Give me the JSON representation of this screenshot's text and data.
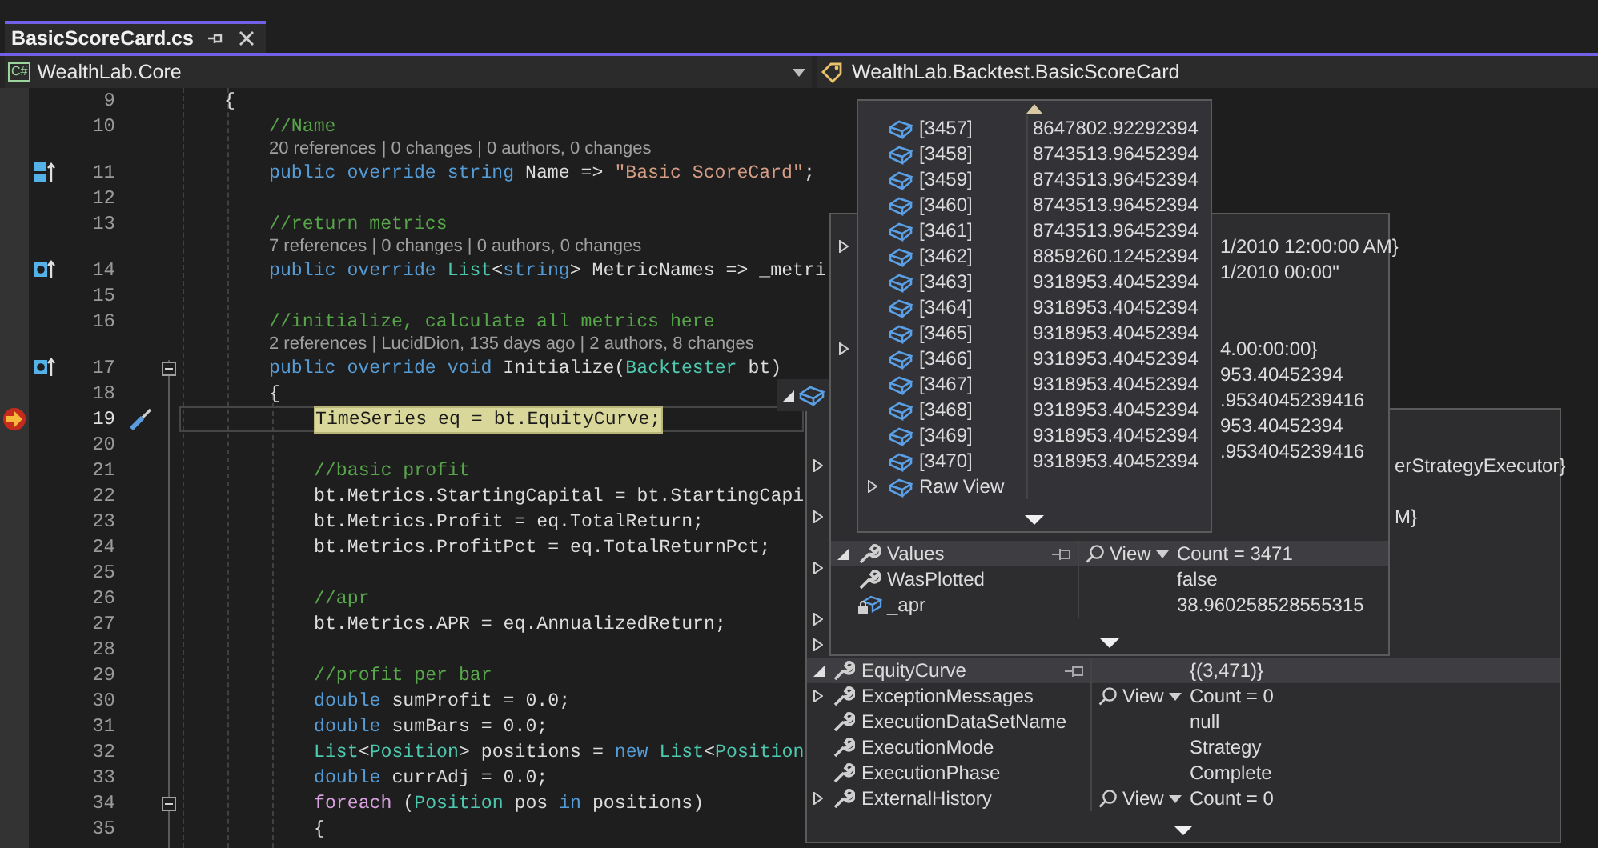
{
  "tabs": [
    {
      "label": "BasicScoreCard.cs",
      "selected": true
    }
  ],
  "navigation": {
    "project_badge": "C#",
    "project": "WealthLab.Core",
    "member": "WealthLab.Backtest.BasicScoreCard"
  },
  "editor": {
    "lines": [
      {
        "kind": "code",
        "number": "9",
        "tokens": [
          {
            "kind": "plain",
            "text": "{"
          }
        ],
        "children": [
          {
            "kind": "code",
            "number": "10",
            "tokens": [
              {
                "kind": "comment",
                "text": "//Name"
              }
            ]
          },
          {
            "kind": "lens",
            "text": "20 references | 0 changes | 0 authors, 0 changes"
          },
          {
            "kind": "property",
            "number": "11",
            "tokens": [
              {
                "kind": "keyword",
                "text": "public override string"
              },
              {
                "kind": "plain",
                "text": " Name => "
              },
              {
                "kind": "string",
                "text": "\"Basic ScoreCard\""
              },
              {
                "kind": "plain",
                "text": ";"
              }
            ]
          },
          {
            "kind": "code",
            "number": "12"
          },
          {
            "kind": "code",
            "number": "13",
            "tokens": [
              {
                "kind": "comment",
                "text": "//return metrics"
              }
            ]
          },
          {
            "kind": "lens",
            "text": "7 references | 0 changes | 0 authors, 0 changes"
          },
          {
            "kind": "method",
            "number": "14",
            "tokens": [
              {
                "kind": "keyword",
                "text": "public override "
              },
              {
                "kind": "type",
                "text": "List"
              },
              {
                "kind": "plain",
                "text": "<"
              },
              {
                "kind": "keyword",
                "text": "string"
              },
              {
                "kind": "plain",
                "text": "> MetricNames => _metri"
              }
            ]
          },
          {
            "kind": "code",
            "number": "15"
          },
          {
            "kind": "code",
            "number": "16",
            "tokens": [
              {
                "kind": "comment",
                "text": "//initialize, calculate all metrics here"
              }
            ]
          },
          {
            "kind": "lens",
            "text": "2 references | LucidDion, 135 days ago | 2 authors, 8 changes"
          },
          {
            "kind": "method",
            "number": "17",
            "expanded": true,
            "tokens": [
              {
                "kind": "keyword",
                "text": "public override void"
              },
              {
                "kind": "plain",
                "text": " Initialize("
              },
              {
                "kind": "type",
                "text": "Backtester"
              },
              {
                "kind": "plain",
                "text": " bt)"
              }
            ]
          },
          {
            "kind": "code",
            "number": "18",
            "tokens": [
              {
                "kind": "plain",
                "text": "{"
              }
            ],
            "children": [
              {
                "kind": "code",
                "number": "19",
                "current": true,
                "tokens": [
                  {
                    "kind": "plain",
                    "text": "TimeSeries eq = bt.EquityCurve;"
                  }
                ]
              },
              {
                "kind": "code",
                "number": "20"
              },
              {
                "kind": "code",
                "number": "21",
                "tokens": [
                  {
                    "kind": "comment",
                    "text": "//basic profit"
                  }
                ]
              },
              {
                "kind": "code",
                "number": "22",
                "tokens": [
                  {
                    "kind": "plain",
                    "text": "bt.Metrics.StartingCapital = bt.StartingCapi"
                  }
                ]
              },
              {
                "kind": "code",
                "number": "23",
                "tokens": [
                  {
                    "kind": "plain",
                    "text": "bt.Metrics.Profit = eq.TotalReturn;"
                  }
                ]
              },
              {
                "kind": "code",
                "number": "24",
                "tokens": [
                  {
                    "kind": "plain",
                    "text": "bt.Metrics.ProfitPct = eq.TotalReturnPct;"
                  }
                ]
              },
              {
                "kind": "code",
                "number": "25"
              },
              {
                "kind": "code",
                "number": "26",
                "tokens": [
                  {
                    "kind": "comment",
                    "text": "//apr"
                  }
                ]
              },
              {
                "kind": "code",
                "number": "27",
                "tokens": [
                  {
                    "kind": "plain",
                    "text": "bt.Metrics.APR = eq.AnnualizedReturn;"
                  }
                ]
              },
              {
                "kind": "code",
                "number": "28"
              },
              {
                "kind": "code",
                "number": "29",
                "tokens": [
                  {
                    "kind": "comment",
                    "text": "//profit per bar"
                  }
                ]
              },
              {
                "kind": "code",
                "number": "30",
                "tokens": [
                  {
                    "kind": "keyword",
                    "text": "double"
                  },
                  {
                    "kind": "plain",
                    "text": " sumProfit = 0.0;"
                  }
                ]
              },
              {
                "kind": "code",
                "number": "31",
                "tokens": [
                  {
                    "kind": "keyword",
                    "text": "double"
                  },
                  {
                    "kind": "plain",
                    "text": " sumBars = 0.0;"
                  }
                ]
              },
              {
                "kind": "code",
                "number": "32",
                "tokens": [
                  {
                    "kind": "type",
                    "text": "List"
                  },
                  {
                    "kind": "plain",
                    "text": "<"
                  },
                  {
                    "kind": "type",
                    "text": "Position"
                  },
                  {
                    "kind": "plain",
                    "text": "> positions = "
                  },
                  {
                    "kind": "keyword",
                    "text": "new "
                  },
                  {
                    "kind": "type",
                    "text": "List"
                  },
                  {
                    "kind": "plain",
                    "text": "<"
                  },
                  {
                    "kind": "type",
                    "text": "Position"
                  }
                ]
              },
              {
                "kind": "code",
                "number": "33",
                "tokens": [
                  {
                    "kind": "keyword",
                    "text": "double"
                  },
                  {
                    "kind": "plain",
                    "text": " currAdj = 0.0;"
                  }
                ]
              },
              {
                "kind": "code",
                "number": "34",
                "expanded": true,
                "tokens": [
                  {
                    "kind": "control",
                    "text": "foreach"
                  },
                  {
                    "kind": "plain",
                    "text": " ("
                  },
                  {
                    "kind": "type",
                    "text": "Position"
                  },
                  {
                    "kind": "plain",
                    "text": " pos "
                  },
                  {
                    "kind": "keyword",
                    "text": "in"
                  },
                  {
                    "kind": "plain",
                    "text": " positions)"
                  }
                ]
              },
              {
                "kind": "code",
                "number": "35",
                "tokens": [
                  {
                    "kind": "plain",
                    "text": "{"
                  }
                ]
              }
            ]
          }
        ]
      }
    ]
  },
  "datatip_root": {
    "expanded": true
  },
  "datatips": [
    {
      "scroll_down": true,
      "rows": [
        {
          "kind": "covered",
          "expanded": false,
          "value": "erStrategyExecutor}"
        },
        {
          "kind": "covered"
        },
        {
          "kind": "covered",
          "expanded": false,
          "value": "M}"
        },
        {
          "kind": "covered"
        },
        {
          "kind": "covered",
          "expanded": false
        },
        {
          "kind": "covered"
        },
        {
          "kind": "covered",
          "expanded": false
        },
        {
          "kind": "covered",
          "expanded": false
        },
        {
          "kind": "property",
          "expanded": true,
          "selected": true,
          "name": "EquityCurve",
          "value": "{(3,471)}"
        },
        {
          "kind": "property",
          "expanded": false,
          "selected": false,
          "name": "ExceptionMessages",
          "viewer": "View",
          "value": "Count = 0"
        },
        {
          "kind": "property",
          "selected": false,
          "name": "ExecutionDataSetName",
          "value": "null"
        },
        {
          "kind": "property",
          "selected": false,
          "name": "ExecutionMode",
          "value": "Strategy"
        },
        {
          "kind": "property",
          "selected": false,
          "name": "ExecutionPhase",
          "value": "Complete"
        },
        {
          "kind": "property",
          "expanded": false,
          "selected": false,
          "name": "ExternalHistory",
          "viewer": "View",
          "value": "Count = 0"
        }
      ]
    },
    {
      "scroll_down": true,
      "rows": [
        {
          "kind": "covered",
          "expanded": false,
          "value": "1/2010 12:00:00 AM}"
        },
        {
          "kind": "covered",
          "value": "1/2010 00:00\""
        },
        {
          "kind": "covered"
        },
        {
          "kind": "covered"
        },
        {
          "kind": "covered",
          "expanded": false,
          "value": "4.00:00:00}"
        },
        {
          "kind": "covered",
          "value": "953.40452394"
        },
        {
          "kind": "covered",
          "value": ".9534045239416"
        },
        {
          "kind": "covered",
          "value": "953.40452394"
        },
        {
          "kind": "covered",
          "value": ".9534045239416"
        },
        {
          "kind": "covered"
        },
        {
          "kind": "covered"
        },
        {
          "kind": "covered"
        },
        {
          "kind": "property",
          "expanded": true,
          "selected": true,
          "name": "Values",
          "viewer": "View",
          "value": "Count = 3471"
        },
        {
          "kind": "property",
          "selected": false,
          "name": "WasPlotted",
          "value": "false"
        },
        {
          "kind": "field",
          "selected": false,
          "name": "_apr",
          "value": "38.960258528555315"
        }
      ]
    },
    {
      "scroll_up": true,
      "scroll_down": true,
      "rows": [
        {
          "kind": "element",
          "selected": false,
          "name": "[3457]",
          "value": "8647802.92292394"
        },
        {
          "kind": "element",
          "selected": false,
          "name": "[3458]",
          "value": "8743513.96452394"
        },
        {
          "kind": "element",
          "selected": false,
          "name": "[3459]",
          "value": "8743513.96452394"
        },
        {
          "kind": "element",
          "selected": false,
          "name": "[3460]",
          "value": "8743513.96452394"
        },
        {
          "kind": "element",
          "selected": false,
          "name": "[3461]",
          "value": "8743513.96452394"
        },
        {
          "kind": "element",
          "selected": false,
          "name": "[3462]",
          "value": "8859260.12452394"
        },
        {
          "kind": "element",
          "selected": false,
          "name": "[3463]",
          "value": "9318953.40452394"
        },
        {
          "kind": "element",
          "selected": false,
          "name": "[3464]",
          "value": "9318953.40452394"
        },
        {
          "kind": "element",
          "selected": false,
          "name": "[3465]",
          "value": "9318953.40452394"
        },
        {
          "kind": "element",
          "selected": false,
          "name": "[3466]",
          "value": "9318953.40452394"
        },
        {
          "kind": "element",
          "selected": false,
          "name": "[3467]",
          "value": "9318953.40452394"
        },
        {
          "kind": "element",
          "selected": false,
          "name": "[3468]",
          "value": "9318953.40452394"
        },
        {
          "kind": "element",
          "selected": false,
          "name": "[3469]",
          "value": "9318953.40452394"
        },
        {
          "kind": "element",
          "selected": false,
          "name": "[3470]",
          "value": "9318953.40452394"
        },
        {
          "kind": "element",
          "expanded": false,
          "selected": false,
          "name": "Raw View"
        }
      ]
    }
  ]
}
